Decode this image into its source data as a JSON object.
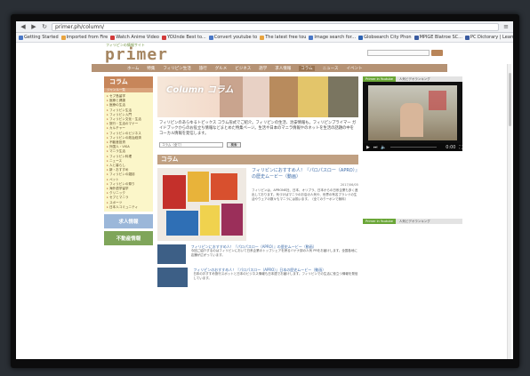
{
  "browser": {
    "url": "primer.ph/column/",
    "bookmarks": [
      {
        "label": "Getting Started",
        "color": "#4a78c7"
      },
      {
        "label": "Imported from Fire",
        "color": "#e8a440"
      },
      {
        "label": "Watch Anime Video",
        "color": "#d23b3b"
      },
      {
        "label": "YOUnde Best to...",
        "color": "#d23b3b"
      },
      {
        "label": "Convert youtube to",
        "color": "#4a78c7"
      },
      {
        "label": "The latest free tou",
        "color": "#e8a440"
      },
      {
        "label": "Image search for...",
        "color": "#4a78c7"
      },
      {
        "label": "Globsearch City Phon",
        "color": "#2e64b3"
      },
      {
        "label": "MPIGE Blatroe SC...",
        "color": "#3a5ba0"
      },
      {
        "label": "PC Dictorary | Learn",
        "color": "#3a5ba0"
      }
    ]
  },
  "site": {
    "logo": "primer",
    "tagline": "フィリピンの情報サイト",
    "nav": [
      "ホーム",
      "特集",
      "フィリピン生活",
      "旅行",
      "グルメ",
      "ビジネス",
      "語学",
      "求人情報",
      "コラム",
      "ニュース",
      "イベント"
    ],
    "nav_highlight": 8
  },
  "sidebar": {
    "title": "コラム",
    "subtitle": "ジャンル一覧",
    "items": [
      "セブ島留学",
      "医療と健康",
      "医療の生活",
      "フィリピン生活",
      "フィリピン入門",
      "フィリピン文化・生活",
      "旅行・生活のマナー",
      "カルチャー",
      "フィリピンのビジネス",
      "フィリピンの政治経済",
      "不動産投資",
      "外国人・VISA",
      "マニラ生活",
      "フィリピン料理",
      "ニュース",
      "人と暮らし",
      "新・おすすめ",
      "フィリピンの雑誌",
      "ペット",
      "フィリピンの祭り",
      "海外語学留学",
      "クリニック",
      "セブとマニラ",
      "スポーツ",
      "日本人コミュニティ"
    ],
    "banners": [
      {
        "label": "求人情報",
        "color": "#9bb7d9"
      },
      {
        "label": "不動産情報",
        "color": "#7fa55a"
      }
    ]
  },
  "main": {
    "hero_title": "Column コラム",
    "intro": "フィリピンのあらゆるトピックス コラム形式でご紹介。フィリピンの生活、治安情報も。フィリピンプライマー ガイドブックからのお役立ち情報などまとめた特集ページ。生活や日本のマニラ情報やのネットを生活の話題の中をコーカル情報を発信します。",
    "select_placeholder": "コラム（全て）",
    "search_button": "検索",
    "section_title": "コラム",
    "article": {
      "title": "フィリピンにおすすめ人！『パロパスロー（APRO）』の歴史ムービー（動画）",
      "date": "2017/06/05",
      "body": "フィリピンは、APRONE社、日本、オリプラ、日本からの日系企業も多く進出しております。気づけばマニラのお店の人気や、世界の有名ブランドの生活やウェアの数々もマニラには揃います。（全てのクーポンで無料）"
    },
    "list": [
      {
        "title": "フィリピンにおすすめ人！『パロパスロー（APRO）』の歴史ムービー（動画）",
        "body": "今回ご紹介するのはフィリピンにおいて日系企業のトップシェアを誇るバナナ卸の人気 PRをお届けします。全国各地に店舗が広がっています。"
      },
      {
        "title": "フィリピンのおすすめ人！『パロパスロー（APRO）』日本の歴史ムービー（動画）",
        "body": "日本のおすすめ旅行スポットと日本のビジネス情報も日本語でお届けします。フィリピンでの生活に役立つ情報を発信しています。"
      }
    ]
  },
  "rightcol": {
    "video_tab_a": "Primer in Youtube",
    "video_tab_b": "人気ビデオランキング",
    "video_time": "0:00"
  }
}
